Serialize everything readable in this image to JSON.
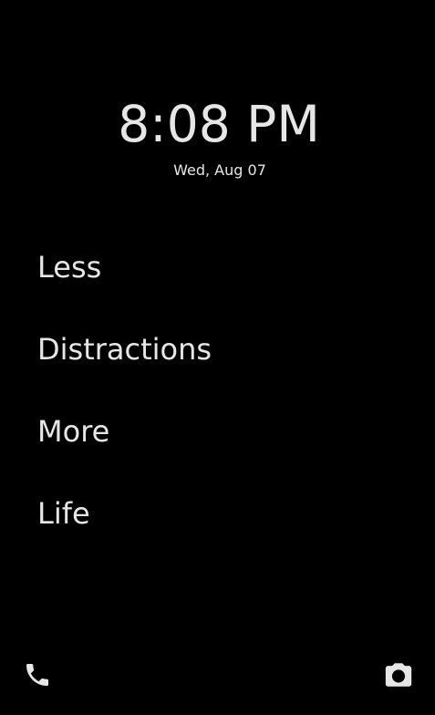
{
  "clock": {
    "time": "8:08 PM",
    "date": "Wed, Aug 07"
  },
  "home_apps": [
    {
      "label": "Less"
    },
    {
      "label": "Distractions"
    },
    {
      "label": "More"
    },
    {
      "label": "Life"
    }
  ],
  "shortcuts": {
    "left_icon": "phone-icon",
    "right_icon": "camera-icon"
  },
  "colors": {
    "background": "#000000",
    "text": "#e6e6e6"
  }
}
